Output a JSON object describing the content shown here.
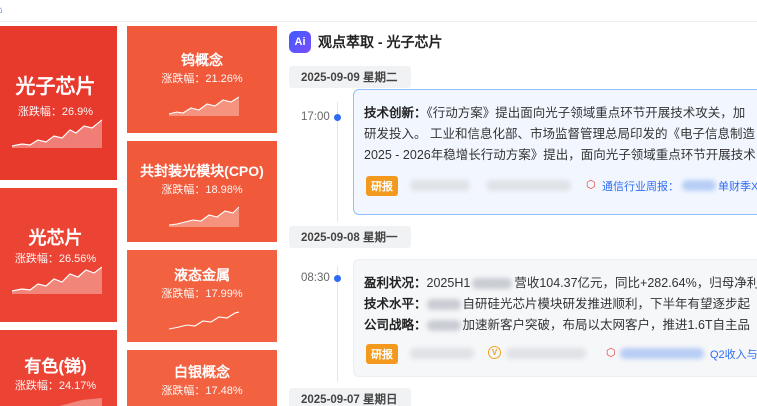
{
  "tiles": [
    {
      "name": "光子芯片",
      "change_label": "涨跌幅：26.9%",
      "change_pct": 26.9,
      "color": "#e8392d"
    },
    {
      "name": "光芯片",
      "change_label": "涨跌幅：26.56%",
      "change_pct": 26.56,
      "color": "#ec4434"
    },
    {
      "name": "有色(锑)",
      "change_label": "涨跌幅：24.17%",
      "change_pct": 24.17,
      "color": "#ec4434"
    },
    {
      "name": "钨概念",
      "change_label": "涨跌幅：21.26%",
      "change_pct": 21.26,
      "color": "#f0593a"
    },
    {
      "name": "共封装光模块(CPO)",
      "change_label": "涨跌幅：18.98%",
      "change_pct": 18.98,
      "color": "#f0593a"
    },
    {
      "name": "液态金属",
      "change_label": "涨跌幅：17.99%",
      "change_pct": 17.99,
      "color": "#f26140"
    },
    {
      "name": "白银概念",
      "change_label": "涨跌幅：17.48%",
      "change_pct": 17.48,
      "color": "#f26140"
    }
  ],
  "header": {
    "badge": "Ai",
    "title": "观点萃取 - 光子芯片"
  },
  "dates": [
    "2025-09-09 星期二",
    "2025-09-08 星期一",
    "2025-09-07 星期日"
  ],
  "entries": [
    {
      "time": "17:00",
      "lines": [
        {
          "label": "技术创新：",
          "text": "《行动方案》提出面向光子领域重点环节开展技术攻关，加"
        },
        {
          "label": "",
          "text": "研发投入。 工业和信息化部、市场监督管理总局印发的《电子信息制造"
        },
        {
          "label": "",
          "text": "2025 - 2026年稳增长行动方案》提出，面向光子领域重点环节开展技术"
        }
      ],
      "tag": "研报",
      "source_label": "通信行业周报：",
      "source_tail": "单财季XPU"
    },
    {
      "time": "08:30",
      "lines": [
        {
          "label": "盈利状况：",
          "text_a": "2025H1",
          "text_b": "营收104.37亿元，同比+282.64%，归母净利"
        },
        {
          "label": "技术水平：",
          "text_b": "自研硅光芯片模块研发推进顺利，下半年有望逐步起"
        },
        {
          "label": "公司战略：",
          "text_b": "加速新客户突破，布局以太网客户，推进1.6T自主品"
        }
      ],
      "tag": "研报",
      "v_badge": "V",
      "source_tail": "Q2收入与"
    }
  ]
}
